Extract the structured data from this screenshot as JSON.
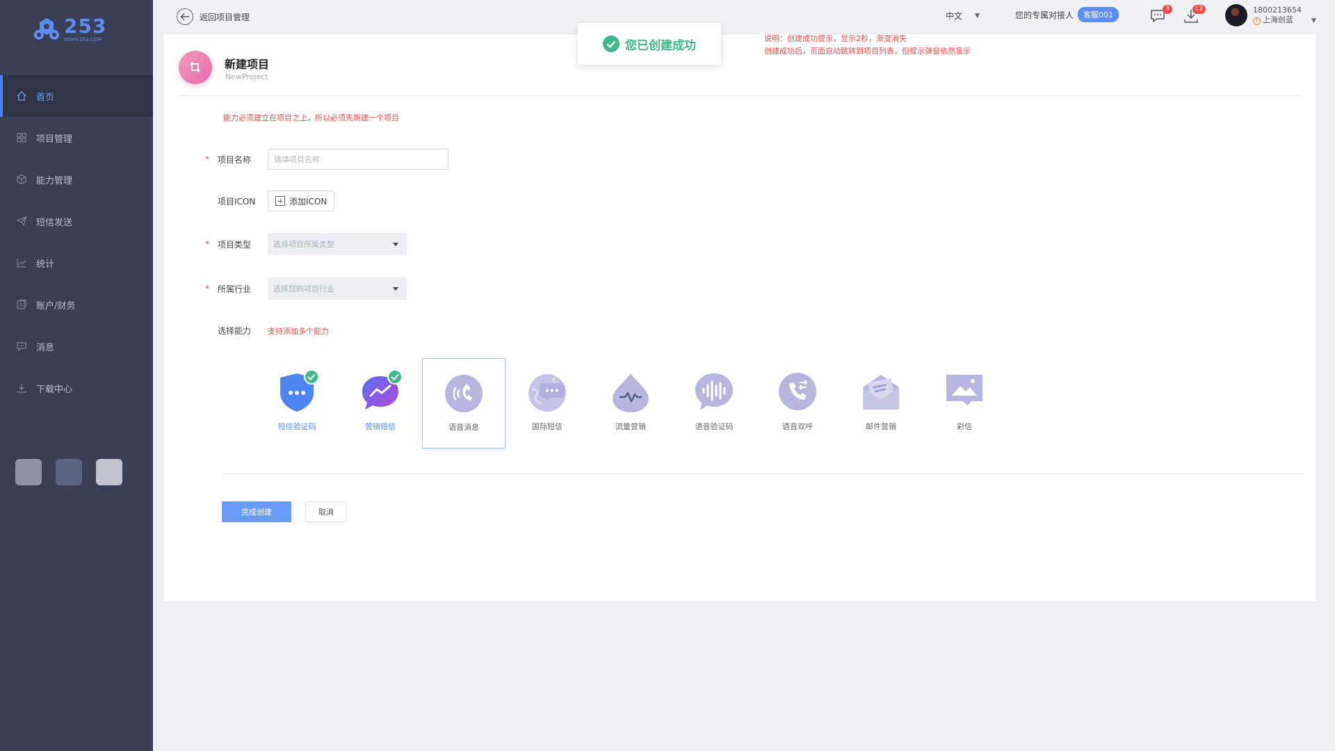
{
  "brand": {
    "logo_number": "253",
    "logo_url": "WWW.253.COM",
    "accent": "#5b8ef5"
  },
  "sidebar": {
    "items": [
      {
        "label": "首页",
        "icon": "home-icon",
        "active": true
      },
      {
        "label": "项目管理",
        "icon": "grid-icon"
      },
      {
        "label": "能力管理",
        "icon": "cube-icon"
      },
      {
        "label": "短信发送",
        "icon": "send-icon"
      },
      {
        "label": "统计",
        "icon": "chart-icon"
      },
      {
        "label": "账户/财务",
        "icon": "wallet-icon"
      },
      {
        "label": "消息",
        "icon": "message-icon"
      },
      {
        "label": "下载中心",
        "icon": "download-icon"
      }
    ],
    "theme_swatches": [
      "#8d93a6",
      "#5c6480",
      "#c1c4cd"
    ]
  },
  "header": {
    "back_label": "返回项目管理",
    "language": "中文",
    "contact_label": "您的专属对接人",
    "contact_name": "客服001",
    "messages_count": "3",
    "downloads_count": "12",
    "user_phone": "1800213654",
    "user_company": "上海创蓝"
  },
  "toast": {
    "text": "您已创建成功"
  },
  "notes": {
    "line1": "说明：创建成功提示，显示2秒，渐变消失",
    "line2": "创建成功后，页面自动跳转到项目列表，但提示弹窗依然显示"
  },
  "page": {
    "title": "新建项目",
    "subtitle": "NewProject",
    "warning": "能力必须建立在项目之上，所以必须先新建一个项目"
  },
  "form": {
    "name_label": "项目名称",
    "name_placeholder": "请填项目名称",
    "icon_label": "项目ICON",
    "icon_button": "添加ICON",
    "type_label": "项目类型",
    "type_placeholder": "选择项目所属类型",
    "industry_label": "所属行业",
    "industry_placeholder": "选择您的项目行业",
    "ability_label": "选择能力",
    "ability_hint": "支持添加多个能力"
  },
  "abilities": [
    {
      "label": "短信验证码",
      "icon": "shield-chat-icon",
      "checked": true
    },
    {
      "label": "营销短信",
      "icon": "marketing-chat-icon",
      "checked": true
    },
    {
      "label": "语音消息",
      "icon": "voice-message-icon",
      "selected": true
    },
    {
      "label": "国际短信",
      "icon": "globe-chat-icon"
    },
    {
      "label": "流量营销",
      "icon": "traffic-drop-icon"
    },
    {
      "label": "语音验证码",
      "icon": "voice-wave-icon"
    },
    {
      "label": "语音双呼",
      "icon": "phone-call-icon"
    },
    {
      "label": "邮件营销",
      "icon": "email-icon"
    },
    {
      "label": "彩信",
      "icon": "image-message-icon"
    }
  ],
  "actions": {
    "submit": "完成创建",
    "cancel": "取消"
  }
}
